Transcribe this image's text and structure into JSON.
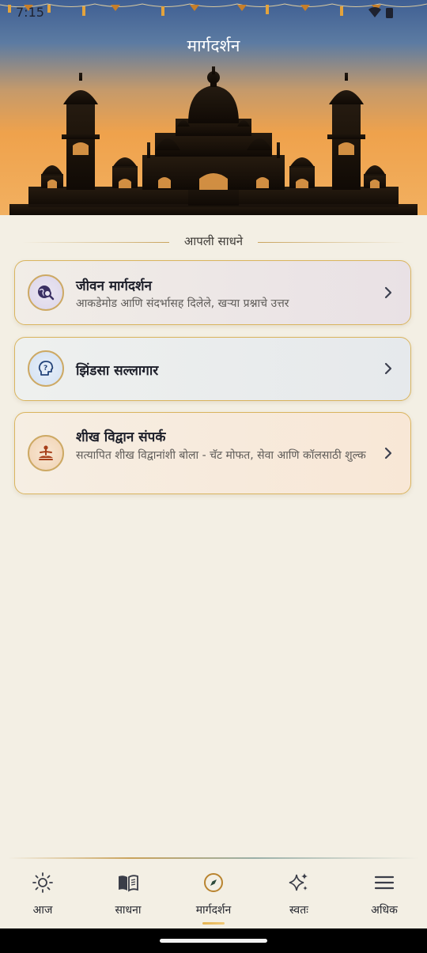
{
  "status_bar": {
    "time": "7:15"
  },
  "header": {
    "title": "मार्गदर्शन"
  },
  "section": {
    "label": "आपली साधने"
  },
  "cards": [
    {
      "icon": "search-globe-icon",
      "title": "जीवन मार्गदर्शन",
      "subtitle": "आकडेमोड आणि संदर्भासह दिलेले, खऱ्या प्रश्नाचे उत्तर"
    },
    {
      "icon": "question-head-icon",
      "title": "झिंडसा सल्लागार",
      "subtitle": ""
    },
    {
      "icon": "meditation-icon",
      "title": "शीख विद्वान संपर्क",
      "subtitle": "सत्यापित शीख विद्वानांशी बोला - चॅट मोफत, सेवा आणि कॉलसाठी शुल्क"
    }
  ],
  "nav": [
    {
      "icon": "sun-icon",
      "label": "आज",
      "active": false
    },
    {
      "icon": "book-icon",
      "label": "साधना",
      "active": false
    },
    {
      "icon": "compass-icon",
      "label": "मार्गदर्शन",
      "active": true
    },
    {
      "icon": "sparkles-icon",
      "label": "स्वतः",
      "active": false
    },
    {
      "icon": "menu-icon",
      "label": "अधिक",
      "active": false
    }
  ],
  "colors": {
    "accent_gold": "#d9b45e",
    "text_primary": "#1d1f2a",
    "text_secondary": "#5d5a57",
    "background": "#f3efe4"
  }
}
